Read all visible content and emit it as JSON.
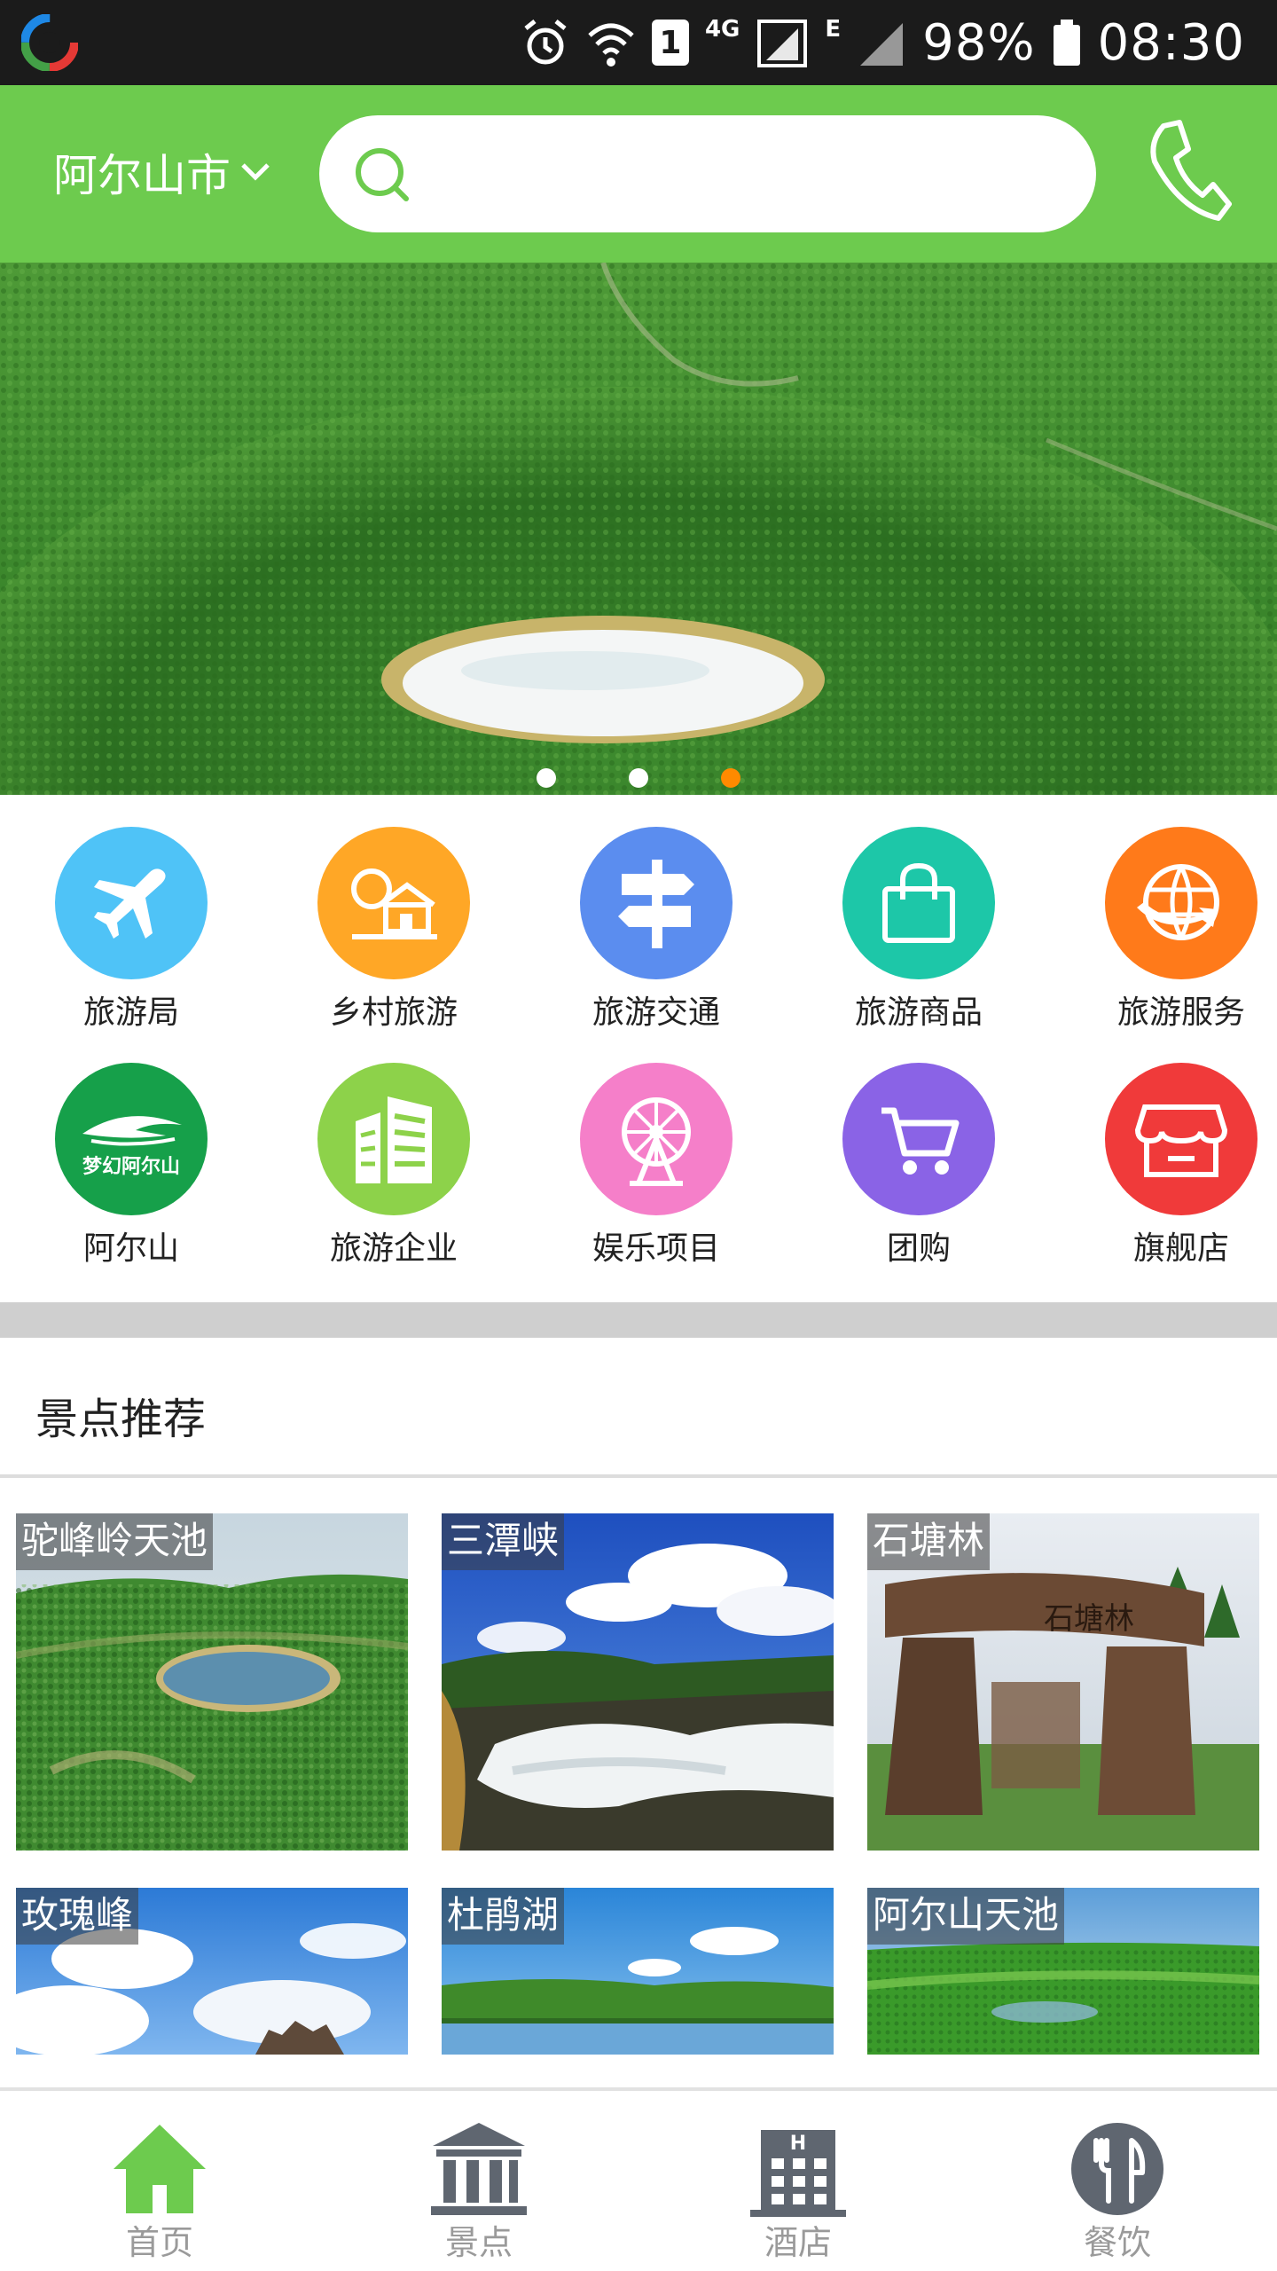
{
  "status_bar": {
    "battery": "98%",
    "time": "08:30",
    "network_4g": "4G",
    "network_e": "E",
    "sim_slot": "1"
  },
  "header": {
    "city": "阿尔山市",
    "search_placeholder": "",
    "brand_color": "#6dcb4e"
  },
  "banner": {
    "slide_count": 3,
    "active_slide": 3
  },
  "categories": [
    {
      "label": "旅游局",
      "icon": "airplane-icon",
      "color": "#4fc3f7"
    },
    {
      "label": "乡村旅游",
      "icon": "village-house-icon",
      "color": "#ffa726"
    },
    {
      "label": "旅游交通",
      "icon": "signpost-icon",
      "color": "#5b8def"
    },
    {
      "label": "旅游商品",
      "icon": "shopping-bag-icon",
      "color": "#1dc7a8"
    },
    {
      "label": "旅游服务",
      "icon": "globe-service-icon",
      "color": "#ff7a1a"
    },
    {
      "label": "阿尔山",
      "icon": "dream-arxan-logo-icon",
      "logo_text": "梦幻阿尔山",
      "color": "#16a04a"
    },
    {
      "label": "旅游企业",
      "icon": "building-icon",
      "color": "#8dd24a"
    },
    {
      "label": "娱乐项目",
      "icon": "ferris-wheel-icon",
      "color": "#f57fc9"
    },
    {
      "label": "团购",
      "icon": "cart-icon",
      "color": "#8a63e6"
    },
    {
      "label": "旗舰店",
      "icon": "storefront-icon",
      "color": "#f03a3a"
    }
  ],
  "recommend": {
    "title": "景点推荐",
    "items": [
      {
        "name": "驼峰岭天池"
      },
      {
        "name": "三潭峡"
      },
      {
        "name": "石塘林",
        "sign_text": "石塘林"
      },
      {
        "name": "玫瑰峰"
      },
      {
        "name": "杜鹃湖"
      },
      {
        "name": "阿尔山天池"
      }
    ]
  },
  "bottom_nav": [
    {
      "label": "首页",
      "icon": "home-icon",
      "active": true
    },
    {
      "label": "景点",
      "icon": "museum-icon",
      "active": false
    },
    {
      "label": "酒店",
      "icon": "hotel-building-icon",
      "active": false
    },
    {
      "label": "餐饮",
      "icon": "fork-knife-icon",
      "active": false
    }
  ],
  "colors": {
    "active_nav": "#6dcb4e",
    "inactive_nav": "#5f6670",
    "dot_active": "#ff8a00"
  }
}
